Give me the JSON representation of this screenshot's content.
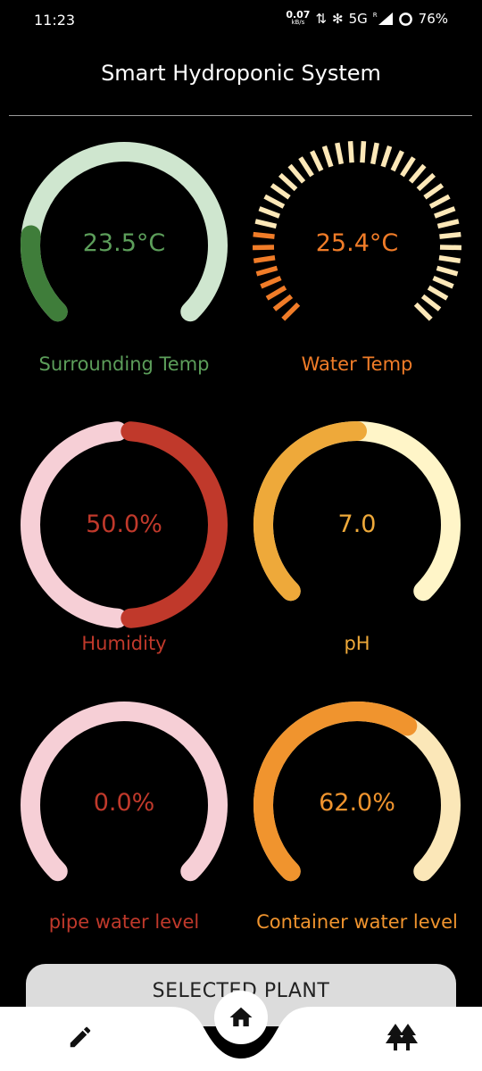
{
  "status_bar": {
    "time": "11:23",
    "net_speed": "0.07",
    "net_unit": "kB/s",
    "network": "5G",
    "roaming": "R",
    "battery": "76%"
  },
  "app": {
    "title": "Smart Hydroponic System"
  },
  "gauges": [
    {
      "value": "23.5°C",
      "label": "Surrounding Temp",
      "fraction": 0.19,
      "track_color": "#cfe6cf",
      "fill_color": "#3f7d3a",
      "text_color": "#5c9e5a",
      "style": "solid"
    },
    {
      "value": "25.4°C",
      "label": "Water Temp",
      "fraction": 0.2,
      "track_color": "#fde8b8",
      "fill_color": "#f07c28",
      "text_color": "#f07c28",
      "style": "segmented"
    },
    {
      "value": "50.0%",
      "label": "Humidity",
      "fraction": 0.5,
      "track_color": "#f6cfd6",
      "fill_color": "#c0392b",
      "text_color": "#c0392b",
      "style": "full-ring"
    },
    {
      "value": "7.0",
      "label": "pH",
      "fraction": 0.5,
      "track_color": "#fff5c8",
      "fill_color": "#eea93a",
      "text_color": "#eea93a",
      "style": "solid"
    },
    {
      "value": "0.0%",
      "label": "pipe water level",
      "fraction": 0.0,
      "track_color": "#f6cfd6",
      "fill_color": "#c0392b",
      "text_color": "#c0392b",
      "style": "solid"
    },
    {
      "value": "62.0%",
      "label": "Container water level",
      "fraction": 0.62,
      "track_color": "#fbe7b8",
      "fill_color": "#f0942e",
      "text_color": "#f0942e",
      "style": "solid"
    }
  ],
  "selected_plant": {
    "label": "SELECTED PLANT"
  },
  "nav": {
    "edit_icon": "pencil-icon",
    "home_icon": "home-icon",
    "plants_icon": "trees-icon"
  }
}
